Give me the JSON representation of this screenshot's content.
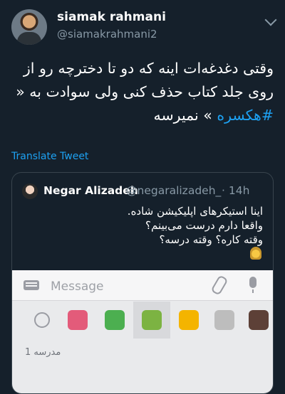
{
  "tweet": {
    "display_name": "siamak rahmani",
    "handle": "@siamakrahmani2",
    "text_lines": [
      "وقتی دغدغه‌ات اینه که دو تا دخترچه رو از",
      "روی جلد کتاب حذف کنی ولی سوادت به «",
      "نمیرسه"
    ],
    "hashtag": "#هکسره",
    "closing_quote": "»",
    "translate_label": "Translate Tweet"
  },
  "quote": {
    "display_name": "Negar Alizadeh",
    "handle": "@negaralizadeh_",
    "time": "· 14h",
    "lines": [
      "اینا استیکرهای اپلیکیشن شاده.",
      "واقعا دارم درست می‌بینم؟",
      "وقته کاره؟ وقته درسه؟"
    ]
  },
  "keyboard": {
    "message_placeholder": "Message",
    "pack_label": "مدرسه 1",
    "tabs": [
      {
        "icon": "emoji-face-icon",
        "color": "#9a9ca3"
      },
      {
        "icon": "sticker-girl-thumb",
        "color": "#e35b7a"
      },
      {
        "icon": "sticker-number-one-thumb",
        "color": "#4caf50"
      },
      {
        "icon": "sticker-word-thumb",
        "color": "#7cb342"
      },
      {
        "icon": "sticker-flower-thumb",
        "color": "#f4b400"
      },
      {
        "icon": "sticker-doodle-thumb",
        "color": "#bdbdbd"
      },
      {
        "icon": "sticker-board-thumb",
        "color": "#5d4037"
      }
    ]
  },
  "colors": {
    "background": "#15202b",
    "link": "#1da1f2",
    "muted": "#8899a6"
  }
}
